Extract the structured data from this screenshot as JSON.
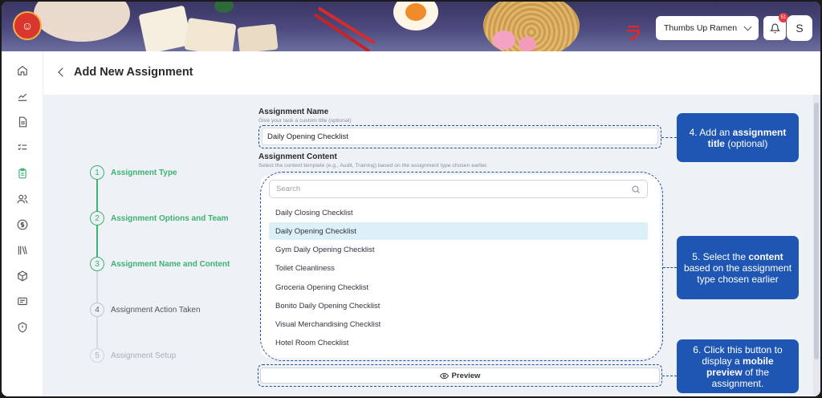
{
  "header": {
    "store_name": "Thumbs Up Ramen",
    "notification_count": "51",
    "avatar_initial": "S"
  },
  "page": {
    "title": "Add New Assignment"
  },
  "steps": [
    {
      "num": "1",
      "label": "Assignment Type",
      "state": "done"
    },
    {
      "num": "2",
      "label": "Assignment Options and Team",
      "state": "done"
    },
    {
      "num": "3",
      "label": "Assignment Name and Content",
      "state": "done"
    },
    {
      "num": "4",
      "label": "Assignment Action Taken",
      "state": "pending"
    },
    {
      "num": "5",
      "label": "Assignment Setup",
      "state": "faded"
    }
  ],
  "form": {
    "name_title": "Assignment Name",
    "name_help": "Give your task a custom title (optional)",
    "name_value": "Daily Opening Checklist",
    "content_title": "Assignment Content",
    "content_help": "Select the content template (e.g., Audit, Training) based on the assignment type chosen earlier.",
    "search_placeholder": "Search",
    "options": [
      "Daily Closing Checklist",
      "Daily Opening Checklist",
      "Gym Daily Opening Checklist",
      "Toilet Cleanliness",
      "Groceria Opening Checklist",
      "Bonito Daily Opening Checklist",
      "Visual Merchandising Checklist",
      "Hotel Room Checklist"
    ],
    "selected_option": "Daily Opening Checklist",
    "preview_label": "Preview"
  },
  "callouts": {
    "c1": {
      "pre": "4. Add an ",
      "bold": "assignment title",
      "post": " (optional)"
    },
    "c2": {
      "pre": "5. Select the ",
      "bold": "content",
      "post": " based on the assignment type chosen earlier"
    },
    "c3": {
      "pre": "6. Click this button to display a ",
      "bold": "mobile preview",
      "post": " of the assignment."
    }
  },
  "colors": {
    "accent_green": "#3cb371",
    "callout_blue": "#1f56b3",
    "selected_row": "#dcf0f8"
  },
  "icons": {
    "sidebar": [
      "home-icon",
      "analytics-icon",
      "document-icon",
      "checklist-icon",
      "clipboard-icon",
      "users-icon",
      "dollar-icon",
      "library-icon",
      "box-icon",
      "chat-icon",
      "shield-icon"
    ]
  }
}
